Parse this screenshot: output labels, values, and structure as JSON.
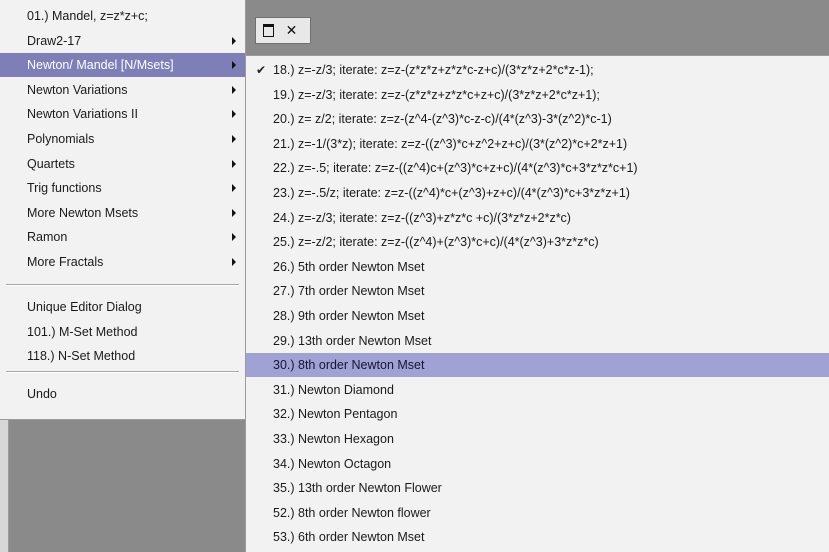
{
  "main_menu": {
    "items": [
      {
        "label": "01.) Mandel, z=z*z+c;",
        "submenu": false
      },
      {
        "label": "Draw2-17",
        "submenu": true
      },
      {
        "label": "Newton/ Mandel [N/Msets]",
        "submenu": true,
        "highlighted": true
      },
      {
        "label": "Newton Variations",
        "submenu": true
      },
      {
        "label": "Newton Variations II",
        "submenu": true
      },
      {
        "label": "Polynomials",
        "submenu": true
      },
      {
        "label": "Quartets",
        "submenu": true
      },
      {
        "label": "Trig functions",
        "submenu": true
      },
      {
        "label": "More Newton Msets",
        "submenu": true
      },
      {
        "label": "Ramon",
        "submenu": true
      },
      {
        "label": "More Fractals",
        "submenu": true
      }
    ],
    "items2": [
      {
        "label": "Unique Editor Dialog"
      },
      {
        "label": "101.) M-Set Method"
      },
      {
        "label": "118.) N-Set Method"
      }
    ],
    "items3": [
      {
        "label": "Undo"
      }
    ]
  },
  "submenu": {
    "checked_mark": "✔",
    "items": [
      {
        "label": "18.) z=-z/3; iterate: z=z-(z*z*z+z*z*c-z+c)/(3*z*z+2*c*z-1);",
        "checked": true
      },
      {
        "label": "19.) z=-z/3; iterate: z=z-(z*z*z+z*z*c+z+c)/(3*z*z+2*c*z+1);"
      },
      {
        "label": "20.) z= z/2; iterate: z=z-(z^4-(z^3)*c-z-c)/(4*(z^3)-3*(z^2)*c-1)"
      },
      {
        "label": "21.) z=-1/(3*z); iterate: z=z-((z^3)*c+z^2+z+c)/(3*(z^2)*c+2*z+1)"
      },
      {
        "label": "22.) z=-.5; iterate: z=z-((z^4)c+(z^3)*c+z+c)/(4*(z^3)*c+3*z*z*c+1)"
      },
      {
        "label": "23.) z=-.5/z; iterate: z=z-((z^4)*c+(z^3)+z+c)/(4*(z^3)*c+3*z*z+1)"
      },
      {
        "label": "24.) z=-z/3;  iterate: z=z-((z^3)+z*z*c +c)/(3*z*z+2*z*c)"
      },
      {
        "label": "25.) z=-z/2;  iterate: z=z-((z^4)+(z^3)*c+c)/(4*(z^3)+3*z*z*c)"
      },
      {
        "label": "26.) 5th order Newton Mset"
      },
      {
        "label": "27.) 7th order Newton Mset"
      },
      {
        "label": "28.) 9th order Newton Mset"
      },
      {
        "label": "29.) 13th order Newton Mset"
      },
      {
        "label": "30.) 8th order Newton Mset",
        "highlighted": true
      },
      {
        "label": "31.) Newton Diamond"
      },
      {
        "label": "32.) Newton Pentagon"
      },
      {
        "label": "33.) Newton Hexagon"
      },
      {
        "label": "34.) Newton Octagon"
      },
      {
        "label": "35.) 13th order Newton Flower"
      },
      {
        "label": "52.) 8th order Newton flower"
      },
      {
        "label": "53.) 6th order Newton Mset"
      }
    ]
  },
  "window_buttons": {
    "maximize_icon": "maximize-icon",
    "close_icon": "close-icon",
    "close_glyph": "✕"
  },
  "colors": {
    "highlight": "#7d7fb6",
    "highlight_sub": "#9fa2d2",
    "menu_bg": "#f2f2f2",
    "desktop_bg": "#8a8a8a"
  }
}
